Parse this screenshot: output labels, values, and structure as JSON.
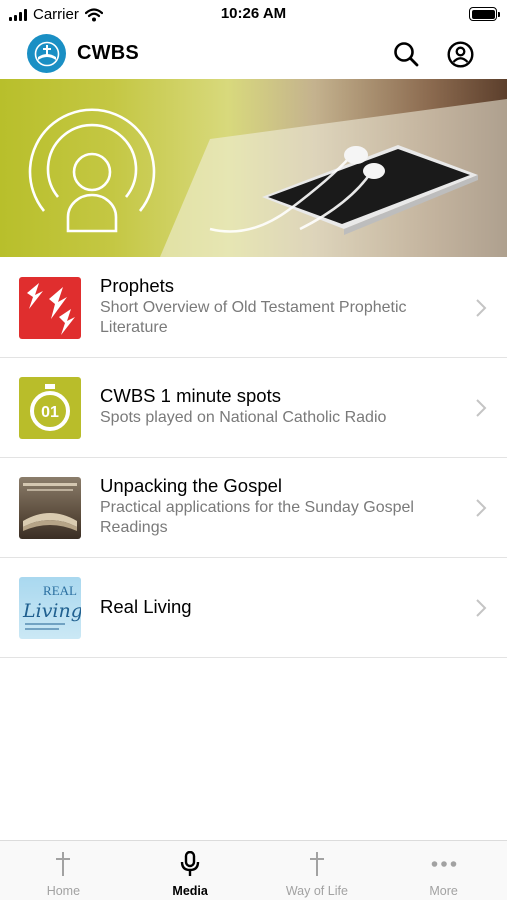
{
  "status_bar": {
    "carrier": "Carrier",
    "time": "10:26 AM"
  },
  "header": {
    "title": "CWBS",
    "icons": [
      "logo-icon",
      "search-icon",
      "account-icon"
    ]
  },
  "banner": {
    "icon": "podcast-icon"
  },
  "media_list": [
    {
      "title": "Prophets",
      "subtitle": "Short Overview of Old Testament Prophetic Literature",
      "thumb": "prophets-thumb",
      "accent": "#e23333"
    },
    {
      "title": "CWBS 1 minute spots",
      "subtitle": "Spots played on National Catholic Radio",
      "thumb": "timer-thumb",
      "thumb_text": "01",
      "accent": "#b9bd2a"
    },
    {
      "title": "Unpacking the Gospel",
      "subtitle": "Practical applications for the Sunday Gospel Readings",
      "thumb": "gospel-book-thumb"
    },
    {
      "title": "Real Living",
      "subtitle": "",
      "thumb": "real-living-thumb",
      "thumb_text": "REAL Living"
    }
  ],
  "tabs": [
    {
      "label": "Home",
      "icon": "cross-icon",
      "active": false
    },
    {
      "label": "Media",
      "icon": "microphone-icon",
      "active": true
    },
    {
      "label": "Way of Life",
      "icon": "cross-icon",
      "active": false
    },
    {
      "label": "More",
      "icon": "more-dots-icon",
      "active": false
    }
  ],
  "colors": {
    "brand_blue": "#1a8fc4",
    "banner_green": "#b8bf2b",
    "subtitle_gray": "#7a7a7a"
  }
}
